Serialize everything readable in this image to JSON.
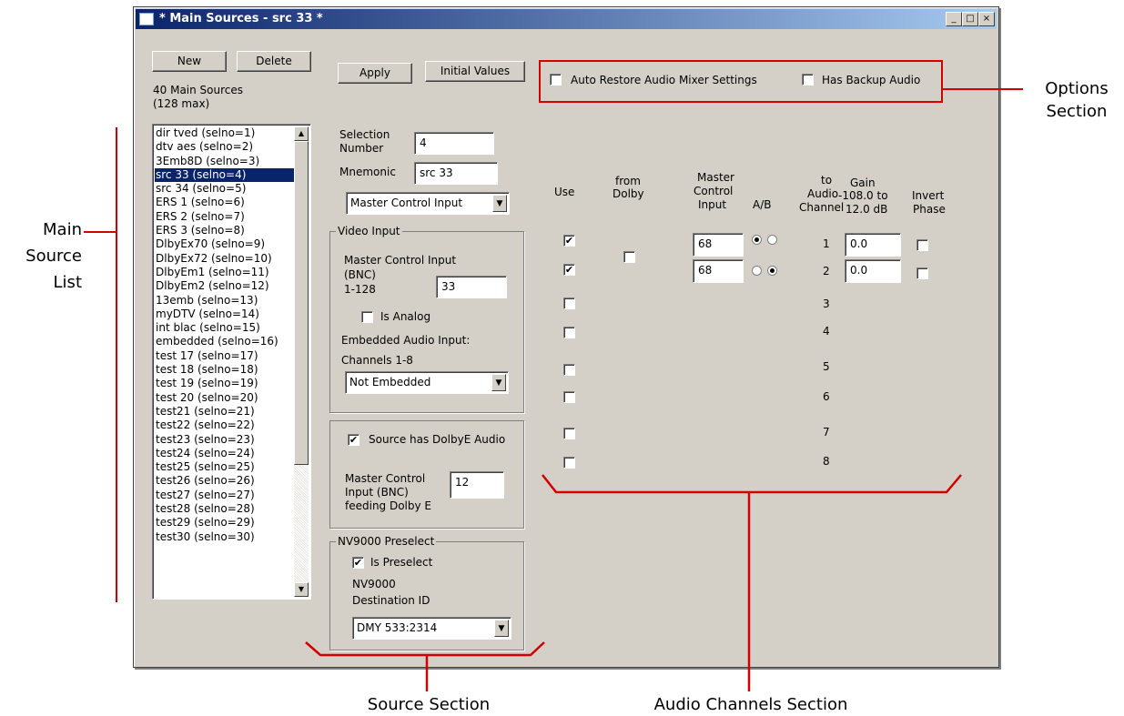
{
  "window": {
    "title": "* Main Sources - src 33 *",
    "controls": [
      "_",
      "□",
      "×"
    ]
  },
  "toolbar": {
    "new_label": "New",
    "delete_label": "Delete",
    "apply_label": "Apply",
    "initial_values_label": "Initial Values",
    "count_line1": "40 Main Sources",
    "count_line2": "(128 max)"
  },
  "options": {
    "auto_restore_label": "Auto Restore Audio Mixer Settings",
    "auto_restore_checked": false,
    "has_backup_label": "Has Backup Audio",
    "has_backup_checked": false
  },
  "source_list": {
    "items": [
      "dir tved (selno=1)",
      "dtv  aes (selno=2)",
      "3Emb8D (selno=3)",
      "src 33 (selno=4)",
      "src 34 (selno=5)",
      "ERS 1 (selno=6)",
      "ERS 2 (selno=7)",
      "ERS 3 (selno=8)",
      "DlbyEx70 (selno=9)",
      "DlbyEx72 (selno=10)",
      "DlbyEm1 (selno=11)",
      "DlbyEm2 (selno=12)",
      "13emb (selno=13)",
      "myDTV (selno=14)",
      "int blac (selno=15)",
      "embedded (selno=16)",
      "test 17 (selno=17)",
      "test 18 (selno=18)",
      "test 19 (selno=19)",
      "test 20 (selno=20)",
      "test21 (selno=21)",
      "test22 (selno=22)",
      "test23 (selno=23)",
      "test24 (selno=24)",
      "test25 (selno=25)",
      "test26 (selno=26)",
      "test27 (selno=27)",
      "test28 (selno=28)",
      "test29 (selno=29)",
      "test30 (selno=30)"
    ],
    "selected_index": 3
  },
  "source": {
    "selection_number_label_1": "Selection",
    "selection_number_label_2": "Number",
    "selection_number_value": "4",
    "mnemonic_label": "Mnemonic",
    "mnemonic_value": "src 33",
    "input_type_value": "Master Control Input"
  },
  "video_input": {
    "title": "Video Input",
    "mci_label_1": "Master Control Input",
    "mci_label_2": "(BNC)",
    "mci_label_3": "1-128",
    "mci_value": "33",
    "is_analog_label": "Is Analog",
    "is_analog_checked": false,
    "embedded_label": "Embedded Audio Input:",
    "channels_label": "Channels 1-8",
    "embedded_value": "Not Embedded"
  },
  "dolby": {
    "has_dolby_label": "Source has DolbyE Audio",
    "has_dolby_checked": true,
    "mci_label_1": "Master Control",
    "mci_label_2": "Input (BNC)",
    "mci_label_3": "feeding Dolby E",
    "mci_value": "12"
  },
  "preselect": {
    "title": "NV9000 Preselect",
    "is_preselect_label": "Is Preselect",
    "is_preselect_checked": true,
    "dest_label_1": "NV9000",
    "dest_label_2": "Destination ID",
    "dest_value": "DMY 533:2314"
  },
  "audio": {
    "headers": {
      "use": "Use",
      "from_dolby_1": "from",
      "from_dolby_2": "Dolby",
      "mci_1": "Master",
      "mci_2": "Control",
      "mci_3": "Input",
      "ab": "A/B",
      "to_1": "to",
      "to_2": "Audio",
      "to_3": "Channel",
      "gain_1": "Gain",
      "gain_2": "-108.0 to",
      "gain_3": "12.0 dB",
      "invert_1": "Invert",
      "invert_2": "Phase"
    },
    "rows": [
      {
        "channel": "1",
        "use": true,
        "from_dolby": false,
        "mci": "68",
        "ab": "A",
        "gain": "0.0",
        "invert": false
      },
      {
        "channel": "2",
        "use": true,
        "from_dolby": null,
        "mci": "68",
        "ab": "B",
        "gain": "0.0",
        "invert": false
      },
      {
        "channel": "3",
        "use": false
      },
      {
        "channel": "4",
        "use": false
      },
      {
        "channel": "5",
        "use": false
      },
      {
        "channel": "6",
        "use": false
      },
      {
        "channel": "7",
        "use": false
      },
      {
        "channel": "8",
        "use": false
      }
    ]
  },
  "annotations": {
    "main_source_list": [
      "Main",
      "Source",
      "List"
    ],
    "options_section": [
      "Options",
      "Section"
    ],
    "source_section": "Source Section",
    "audio_channels_section": "Audio Channels Section"
  },
  "colors": {
    "window_bg": "#d4d0c8",
    "titlebar_start": "#0a246a",
    "titlebar_end": "#a6caf0",
    "selection": "#0a246a",
    "annotation": "#d40000"
  }
}
